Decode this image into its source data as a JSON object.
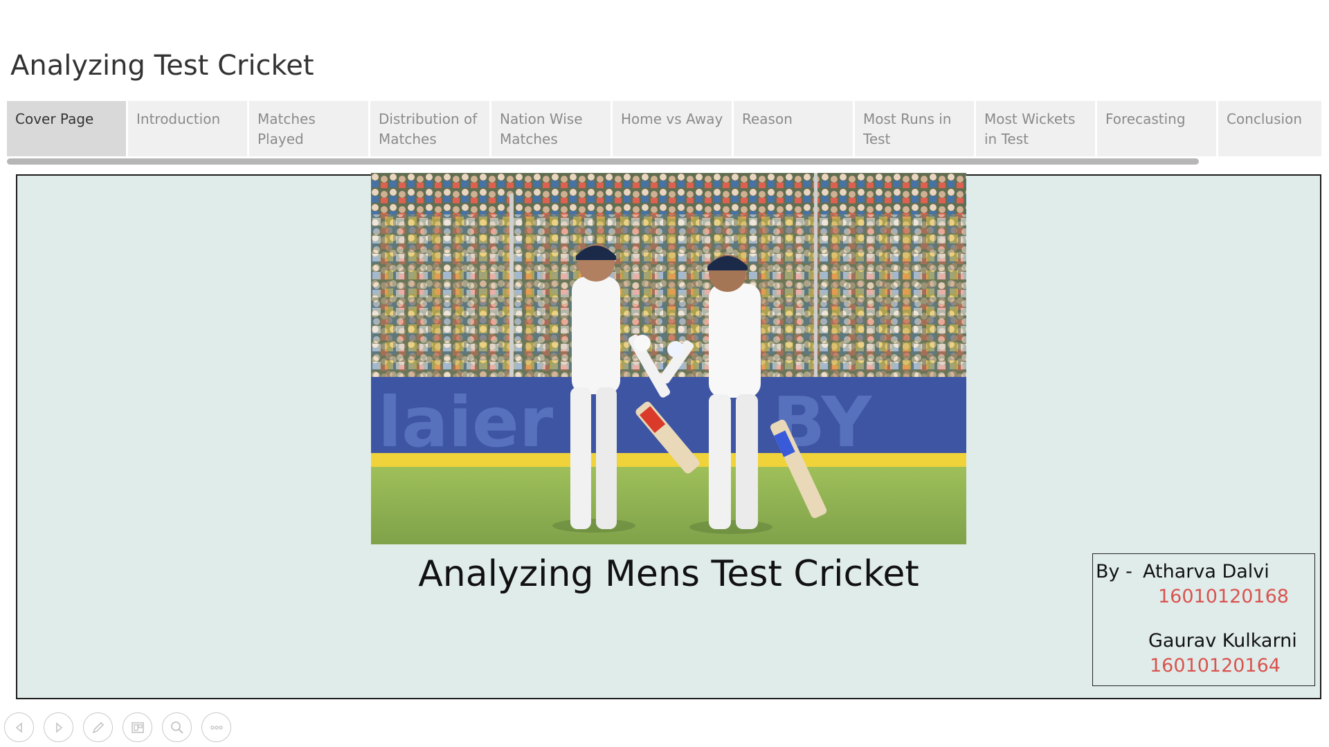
{
  "story": {
    "title": "Analyzing Test Cricket"
  },
  "tabs": [
    {
      "label": "Cover Page",
      "active": true
    },
    {
      "label": "Introduction",
      "active": false
    },
    {
      "label": "Matches Played",
      "active": false
    },
    {
      "label": "Distribution of Matches",
      "active": false
    },
    {
      "label": "Nation Wise Matches",
      "active": false
    },
    {
      "label": "Home vs Away",
      "active": false
    },
    {
      "label": "Reason",
      "active": false
    },
    {
      "label": "Most Runs in Test",
      "active": false
    },
    {
      "label": "Most Wickets in Test",
      "active": false
    },
    {
      "label": "Forecasting",
      "active": false
    },
    {
      "label": "Conclusion",
      "active": false
    }
  ],
  "cover": {
    "heading": "Analyzing Mens Test Cricket",
    "photo_description_icon": "cricket-players-photo",
    "background_color": "#e0ecea"
  },
  "authors": {
    "by_label": "By -",
    "author1_name": "Atharva Dalvi",
    "author1_id": "16010120168",
    "author2_name": "Gaurav Kulkarni",
    "author2_id": "16010120164",
    "id_color": "#d9534f"
  },
  "toolbar": {
    "buttons": [
      "back-icon",
      "forward-icon",
      "edit-icon",
      "layout-icon",
      "zoom-icon",
      "more-icon"
    ]
  }
}
